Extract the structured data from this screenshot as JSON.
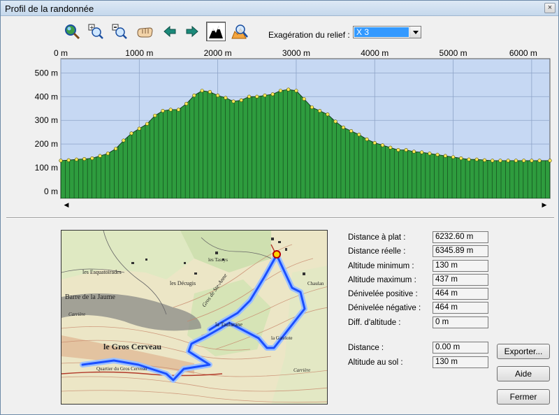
{
  "window": {
    "title": "Profil de la randonnée",
    "close_glyph": "×"
  },
  "toolbar": {
    "tools": [
      {
        "name": "zoom-global-icon",
        "tooltip": ""
      },
      {
        "name": "zoom-in-icon"
      },
      {
        "name": "zoom-out-icon"
      },
      {
        "name": "pan-hand-icon"
      },
      {
        "name": "arrow-left-icon"
      },
      {
        "name": "arrow-right-icon"
      },
      {
        "name": "relief-profile-icon",
        "pressed": true
      },
      {
        "name": "profile-search-icon"
      }
    ],
    "exaggeration_label": "Exagération du relief :",
    "exaggeration_value": "X 3"
  },
  "colors": {
    "plot_background": "#c6d8f3",
    "profile_fill": "#2e9c3e",
    "profile_stroke": "#0b2f10",
    "point_fill": "#ffea5a",
    "gridline": "#8ea4c8",
    "route": "#1a4fff",
    "route_halo": "#9cc0ff"
  },
  "chart_data": {
    "type": "area",
    "x_tick_labels": [
      "0 m",
      "1000 m",
      "2000 m",
      "3000 m",
      "4000 m",
      "5000 m",
      "6000 m"
    ],
    "x_ticks": [
      0,
      1000,
      2000,
      3000,
      4000,
      5000,
      6000
    ],
    "y_tick_labels": [
      "0 m",
      "100 m",
      "200 m",
      "300 m",
      "400 m",
      "500 m"
    ],
    "y_ticks": [
      0,
      100,
      200,
      300,
      400,
      500
    ],
    "xlim": [
      0,
      6232.6
    ],
    "ylim": [
      0,
      560
    ],
    "grid": true,
    "series": [
      {
        "x": [
          0,
          100,
          200,
          300,
          400,
          500,
          600,
          700,
          800,
          900,
          1000,
          1100,
          1200,
          1300,
          1400,
          1500,
          1600,
          1700,
          1800,
          1900,
          2000,
          2100,
          2200,
          2300,
          2400,
          2500,
          2600,
          2700,
          2800,
          2900,
          3000,
          3100,
          3200,
          3300,
          3400,
          3500,
          3600,
          3700,
          3800,
          3900,
          4000,
          4100,
          4200,
          4300,
          4400,
          4500,
          4600,
          4700,
          4800,
          4900,
          5000,
          5100,
          5200,
          5300,
          5400,
          5500,
          5600,
          5700,
          5800,
          5900,
          6000,
          6100,
          6232.6
        ],
        "y": [
          130,
          132,
          135,
          137,
          140,
          150,
          160,
          180,
          215,
          245,
          265,
          285,
          320,
          340,
          345,
          345,
          370,
          405,
          425,
          420,
          405,
          395,
          380,
          385,
          400,
          400,
          405,
          410,
          425,
          430,
          425,
          390,
          355,
          340,
          325,
          295,
          270,
          255,
          240,
          220,
          205,
          195,
          185,
          175,
          175,
          168,
          165,
          160,
          155,
          150,
          145,
          140,
          135,
          135,
          132,
          130,
          130,
          130,
          130,
          130,
          130,
          130,
          130
        ]
      }
    ]
  },
  "stats": [
    {
      "label": "Distance à plat :",
      "value": "6232.60 m"
    },
    {
      "label": "Distance réelle :",
      "value": "6345.89 m"
    },
    {
      "label": "Altitude minimum :",
      "value": "130 m"
    },
    {
      "label": "Altitude maximum :",
      "value": "437 m"
    },
    {
      "label": "Dénivelée positive :",
      "value": "464 m"
    },
    {
      "label": "Dénivelée négative :",
      "value": "464 m"
    },
    {
      "label": "Diff. d'altitude :",
      "value": "0 m"
    }
  ],
  "cursor": [
    {
      "label": "Distance :",
      "value": "0.00 m"
    },
    {
      "label": "Altitude au sol :",
      "value": "130 m"
    }
  ],
  "buttons": {
    "export": "Exporter...",
    "help": "Aide",
    "close": "Fermer"
  },
  "map": {
    "labels": [
      "les Esquatoirades",
      "Barre de la Jaume",
      "Carrière",
      "le Gros Cerveau",
      "les Décugis",
      "Gros de Ste-Anne",
      "la Taularane",
      "les Tassys",
      "Chaulan",
      "la Gatelote",
      "Carrière",
      "Quartier du Gros Cerveau"
    ]
  }
}
